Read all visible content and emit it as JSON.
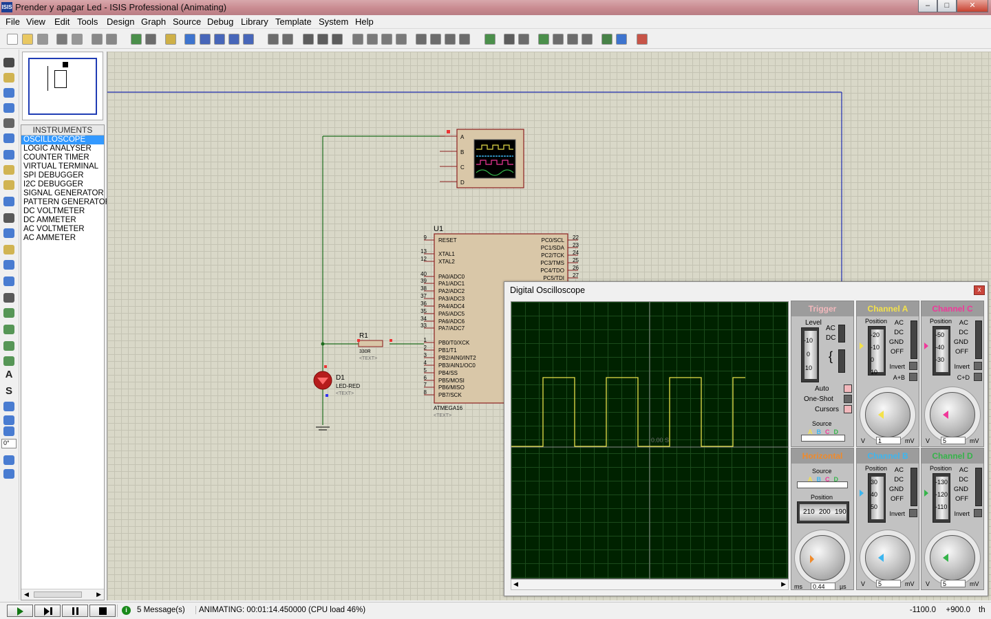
{
  "window": {
    "title": "Prender y apagar Led - ISIS Professional (Animating)",
    "app_icon": "ISIS",
    "min": "–",
    "max": "□",
    "close": "✕"
  },
  "menu": [
    "File",
    "View",
    "Edit",
    "Tools",
    "Design",
    "Graph",
    "Source",
    "Debug",
    "Library",
    "Template",
    "System",
    "Help"
  ],
  "instruments": {
    "header": "INSTRUMENTS",
    "items": [
      "OSCILLOSCOPE",
      "LOGIC ANALYSER",
      "COUNTER TIMER",
      "VIRTUAL TERMINAL",
      "SPI DEBUGGER",
      "I2C DEBUGGER",
      "SIGNAL GENERATOR",
      "PATTERN GENERATOR",
      "DC VOLTMETER",
      "DC AMMETER",
      "AC VOLTMETER",
      "AC AMMETER"
    ],
    "selected_index": 0
  },
  "rotation": "0°",
  "schematic": {
    "scope_pins": [
      "A",
      "B",
      "C",
      "D"
    ],
    "u1_ref": "U1",
    "u1_part": "ATMEGA16",
    "text_placeholder": "<TEXT>",
    "u1_left_pins": [
      [
        "9",
        "RESET"
      ],
      [
        "13",
        "XTAL1"
      ],
      [
        "12",
        "XTAL2"
      ],
      [
        "40",
        "PA0/ADC0"
      ],
      [
        "39",
        "PA1/ADC1"
      ],
      [
        "38",
        "PA2/ADC2"
      ],
      [
        "37",
        "PA3/ADC3"
      ],
      [
        "36",
        "PA4/ADC4"
      ],
      [
        "35",
        "PA5/ADC5"
      ],
      [
        "34",
        "PA6/ADC6"
      ],
      [
        "33",
        "PA7/ADC7"
      ],
      [
        "1",
        "PB0/T0/XCK"
      ],
      [
        "2",
        "PB1/T1"
      ],
      [
        "3",
        "PB2/AIN0/INT2"
      ],
      [
        "4",
        "PB3/AIN1/OC0"
      ],
      [
        "5",
        "PB4/SS"
      ],
      [
        "6",
        "PB5/MOSI"
      ],
      [
        "7",
        "PB6/MISO"
      ],
      [
        "8",
        "PB7/SCK"
      ]
    ],
    "u1_right_pins": [
      [
        "22",
        "PC0/SCL"
      ],
      [
        "23",
        "PC1/SDA"
      ],
      [
        "24",
        "PC2/TCK"
      ],
      [
        "25",
        "PC3/TMS"
      ],
      [
        "26",
        "PC4/TDO"
      ],
      [
        "27",
        "PC5/TDI"
      ]
    ],
    "r1_ref": "R1",
    "r1_value": "330R",
    "d1_ref": "D1",
    "d1_value": "LED-RED"
  },
  "oscilloscope": {
    "title": "Digital Oscilloscope",
    "close": "x",
    "time_marker": "0.00 S",
    "trigger": {
      "title": "Trigger",
      "level_label": "Level",
      "level_ticks": [
        "-10",
        "0",
        "10"
      ],
      "ac": "AC",
      "dc": "DC",
      "auto": "Auto",
      "oneshot": "One-Shot",
      "cursors": "Cursors",
      "source": "Source",
      "sources": [
        "A",
        "B",
        "C",
        "D"
      ]
    },
    "channel_a": {
      "title": "Channel A",
      "position": "Position",
      "ticks": [
        "-20",
        "-10",
        "0",
        "10"
      ],
      "modes": [
        "AC",
        "DC",
        "GND",
        "OFF"
      ],
      "invert": "Invert",
      "sum": "A+B",
      "value": "1",
      "unit_left": "V",
      "unit_right": "mV",
      "scale": [
        "0.5",
        "1",
        "2",
        "5",
        "10",
        "20",
        "50",
        "0.1",
        "0.2",
        "0.5",
        "1",
        "2",
        "5",
        "10",
        "20"
      ]
    },
    "channel_b": {
      "title": "Channel B",
      "position": "Position",
      "ticks": [
        "30",
        "40",
        "50"
      ],
      "modes": [
        "AC",
        "DC",
        "GND",
        "OFF"
      ],
      "invert": "Invert",
      "value": "5",
      "unit_left": "V",
      "unit_right": "mV"
    },
    "channel_c": {
      "title": "Channel C",
      "position": "Position",
      "ticks": [
        "-50",
        "-40",
        "-30"
      ],
      "modes": [
        "AC",
        "DC",
        "GND",
        "OFF"
      ],
      "invert": "Invert",
      "sum": "C+D",
      "value": "5",
      "unit_left": "V",
      "unit_right": "mV"
    },
    "channel_d": {
      "title": "Channel D",
      "position": "Position",
      "ticks": [
        "-130",
        "-120",
        "-110"
      ],
      "modes": [
        "AC",
        "DC",
        "GND",
        "OFF"
      ],
      "invert": "Invert",
      "value": "5",
      "unit_left": "V",
      "unit_right": "mV"
    },
    "horizontal": {
      "title": "Horizontal",
      "source": "Source",
      "position": "Position",
      "pos_ticks": [
        "210",
        "200",
        "190"
      ],
      "value": "0.44",
      "unit_left": "ms",
      "unit_right": "µs"
    },
    "trace": {
      "levels": [
        0,
        1
      ],
      "period_divs": 4.6,
      "duty": 0.5,
      "start_div": 2.3,
      "color": "#e8e04a"
    },
    "colors": {
      "trigger": "#f2b8bc",
      "a": "#f4e24a",
      "b": "#3cb6f0",
      "c": "#f0389a",
      "d": "#35b44a",
      "horizontal": "#f08a2a"
    }
  },
  "status": {
    "messages": "5 Message(s)",
    "animating": "ANIMATING: 00:01:14.450000 (CPU load 46%)",
    "x": "-1100.0",
    "y": "+900.0",
    "unit": "th"
  }
}
